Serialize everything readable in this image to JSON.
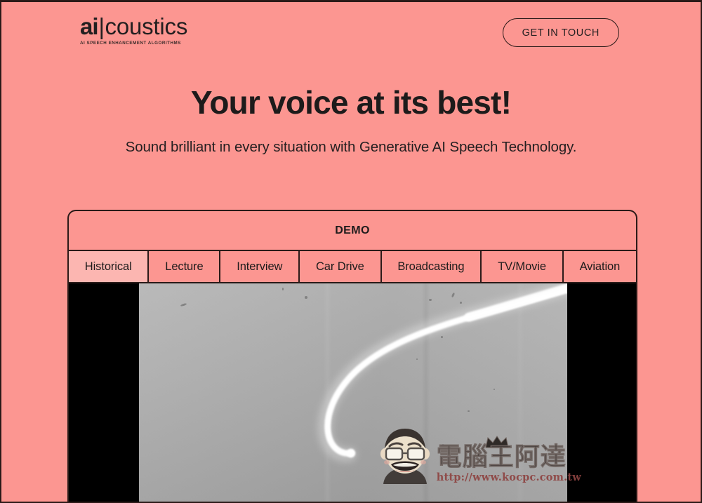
{
  "theme": {
    "background": "#fc9691",
    "ink": "#231f20",
    "border": "#2b1a18",
    "tab_active_bg": "#fcb6b1",
    "video_letterbox": "#000000",
    "video_wall": "#aeaeae",
    "watermark_url_color": "#8e4442"
  },
  "header": {
    "logo": {
      "prefix": "ai",
      "divider": "|",
      "suffix": "coustics",
      "tagline": "AI SPEECH ENHANCEMENT ALGORITHMS"
    },
    "cta_label": "GET IN TOUCH"
  },
  "hero": {
    "title": "Your voice at its best!",
    "subtitle": "Sound brilliant in every situation with Generative AI Speech Technology."
  },
  "demo": {
    "section_title": "DEMO",
    "active_tab_index": 0,
    "tabs": [
      {
        "label": "Historical",
        "active": true
      },
      {
        "label": "Lecture",
        "active": false
      },
      {
        "label": "Interview",
        "active": false
      },
      {
        "label": "Car Drive",
        "active": false
      },
      {
        "label": "Broadcasting",
        "active": false
      },
      {
        "label": "TV/Movie",
        "active": false
      },
      {
        "label": "Aviation",
        "active": false
      }
    ]
  },
  "watermark": {
    "brand_cjk": "電腦王阿達",
    "url": "http://www.kocpc.com.tw"
  }
}
